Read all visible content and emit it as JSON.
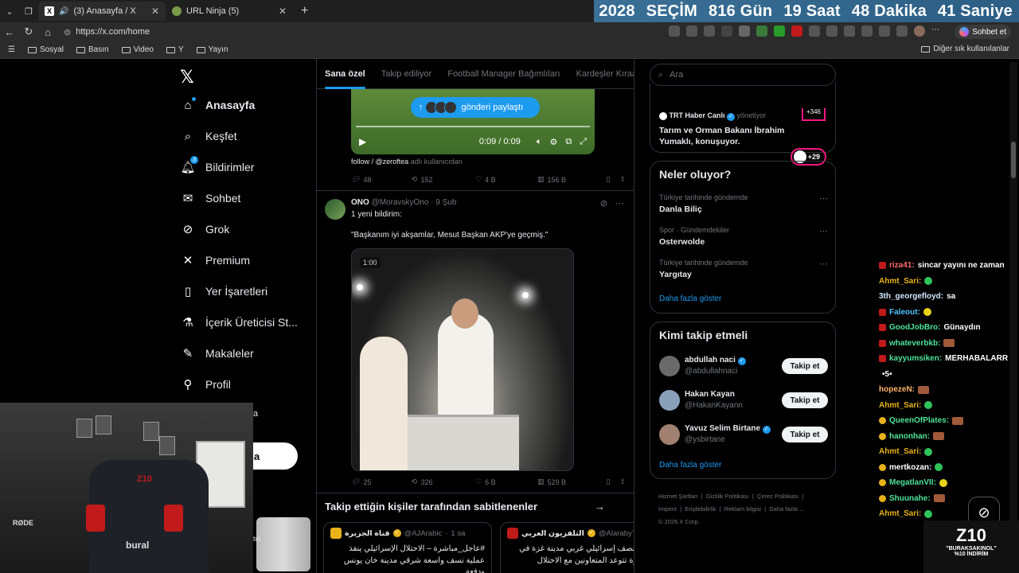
{
  "browser": {
    "tabs": [
      {
        "title": "(3) Anasayfa / X",
        "active": true
      },
      {
        "title": "URL Ninja (5)",
        "active": false
      }
    ],
    "url": "https://x.com/home",
    "chat_button": "Sohbet et",
    "bookmarks": [
      "Sosyal",
      "Basın",
      "Video",
      "Y",
      "Yayın"
    ],
    "other_bookmarks": "Diğer sık kullanılanlar"
  },
  "countdown": [
    "2028",
    "SEÇİM",
    "816 Gün",
    "19 Saat",
    "48 Dakika",
    "41 Saniye"
  ],
  "nav": {
    "items": [
      {
        "label": "Anasayfa"
      },
      {
        "label": "Keşfet"
      },
      {
        "label": "Bildirimler",
        "badge": "3"
      },
      {
        "label": "Sohbet"
      },
      {
        "label": "Grok"
      },
      {
        "label": "Premium"
      },
      {
        "label": "Yer İşaretleri"
      },
      {
        "label": "İçerik Üreticisi St..."
      },
      {
        "label": "Makaleler"
      },
      {
        "label": "Profil"
      }
    ],
    "post_button": "ınla",
    "ghost": "a"
  },
  "feed": {
    "tabs": [
      "Sana özel",
      "Takip ediliyor",
      "Football Manager Bağımlıları",
      "Kardeşler Kıraath"
    ],
    "video1": {
      "share": "gönderi paylaştı",
      "time": "0:09 / 0:09"
    },
    "follow_line": {
      "text": "follow / @zeroftea",
      "suffix": "adlı kullanıcıdan"
    },
    "post1_actions": {
      "replies": "48",
      "reposts": "152",
      "likes": "4 B",
      "views": "156 B"
    },
    "post2": {
      "name": "ONO",
      "handle": "@MoravskyOno",
      "date": "9 Şub",
      "text": "1 yeni bildirim:",
      "quote": "\"Başkanım iyi akşamlar, Mesut Başkan AKP'ye geçmiş.\"",
      "video_time": "1:00",
      "replies": "25",
      "reposts": "326",
      "likes": "6 B",
      "views": "529 B"
    },
    "pinned_title": "Takip ettiğin kişiler tarafından sabitlenenler",
    "cards": [
      {
        "name": "قناة الجزيرة",
        "handle": "@AJArabic",
        "time": "1 sa",
        "body": "#عاجل_مباشرة – الاحتلال الإسرائيلي ينفذ عملية نسف واسعة شرقي مدينة خان يونس ودفعة"
      },
      {
        "name": "التلفزيون العربي",
        "handle": "@AlarabyTV",
        "time": "",
        "body": "شهداء بقصف إسرائيلي غربي مدينة غزة في قطاع غزة تتوعد المتعاونين مع الاحتلال"
      }
    ]
  },
  "right": {
    "search_placeholder": "Ara",
    "live": {
      "top_badge": "+346",
      "host": "TRT Haber Canlı",
      "role": "yönetiyor",
      "title": "Tarım ve Orman Bakanı İbrahim Yumaklı, konuşuyor.",
      "count": "+29"
    },
    "trends_title": "Neler oluyor?",
    "trends": [
      {
        "context": "Türkiye tarihinde gündemde",
        "name": "Danla Biliç"
      },
      {
        "context": "Spor · Gündemdekiler",
        "name": "Osterwolde"
      },
      {
        "context": "Türkiye tarihinde gündemde",
        "name": "Yargıtay"
      }
    ],
    "show_more": "Daha fazla göster",
    "who_title": "Kimi takip etmeli",
    "who": [
      {
        "name": "abdullah naci",
        "handle": "@abdullahnaci",
        "verified": true
      },
      {
        "name": "Hakan Kayan",
        "handle": "@HakanKayann",
        "verified": false
      },
      {
        "name": "Yavuz Selim Birtane",
        "handle": "@ysbirtane",
        "verified": true
      }
    ],
    "follow_label": "Takip et",
    "footer": [
      "Hizmet Şartları",
      "Gizlilik Politikası",
      "Çerez Politikası",
      "Imprint",
      "Erişilebilirlik",
      "Reklam bilgisi",
      "Daha fazla ...",
      "© 2026 X Corp."
    ]
  },
  "stream": {
    "webcam_labels": {
      "mic": "RØDE",
      "chair": "bural",
      "chair_logo": "Z10"
    },
    "glass_label": "tol",
    "chat": [
      {
        "user": "riza41:",
        "msg": "sincar yayını ne zaman",
        "badge": "red"
      },
      {
        "user": "Ahmt_Sari:",
        "msg": "",
        "emote": "green"
      },
      {
        "user": "3th_georgefloyd:",
        "msg": "sa"
      },
      {
        "user": "Faleout:",
        "msg": "",
        "badge": "red",
        "emote": "bird"
      },
      {
        "user": "GoodJobBro:",
        "msg": "Günaydın",
        "badge": "red"
      },
      {
        "user": "whateverbkb:",
        "msg": "",
        "badge": "red",
        "emote": "brick"
      },
      {
        "user": "kayyumsiken:",
        "msg": "MERHABALARR",
        "badge": "red"
      },
      {
        "user": "",
        "msg": "•5•"
      },
      {
        "user": "hopezeN:",
        "msg": "",
        "emote": "brick"
      },
      {
        "user": "Ahmt_Sari:",
        "msg": "",
        "emote": "green"
      },
      {
        "user": "QueenOfPlates:",
        "msg": "",
        "badge": "y",
        "emote": "brick"
      },
      {
        "user": "hanonhan:",
        "msg": "",
        "badge": "y",
        "emote": "brick"
      },
      {
        "user": "Ahmt_Sari:",
        "msg": "",
        "emote": "green"
      },
      {
        "user": "mertkozan:",
        "msg": "",
        "badge": "y",
        "emote": "green"
      },
      {
        "user": "MegatlanVII:",
        "msg": "",
        "badge": "y",
        "emote": "bird"
      },
      {
        "user": "Shuunahe:",
        "msg": "",
        "badge": "y",
        "emote": "brick"
      },
      {
        "user": "Ahmt_Sari:",
        "msg": "",
        "emote": "green"
      }
    ],
    "brand": {
      "logo": "Z10",
      "promo1": "\"BURAKSAKINOL\"",
      "promo2": "%10 İNDİRİM"
    }
  }
}
